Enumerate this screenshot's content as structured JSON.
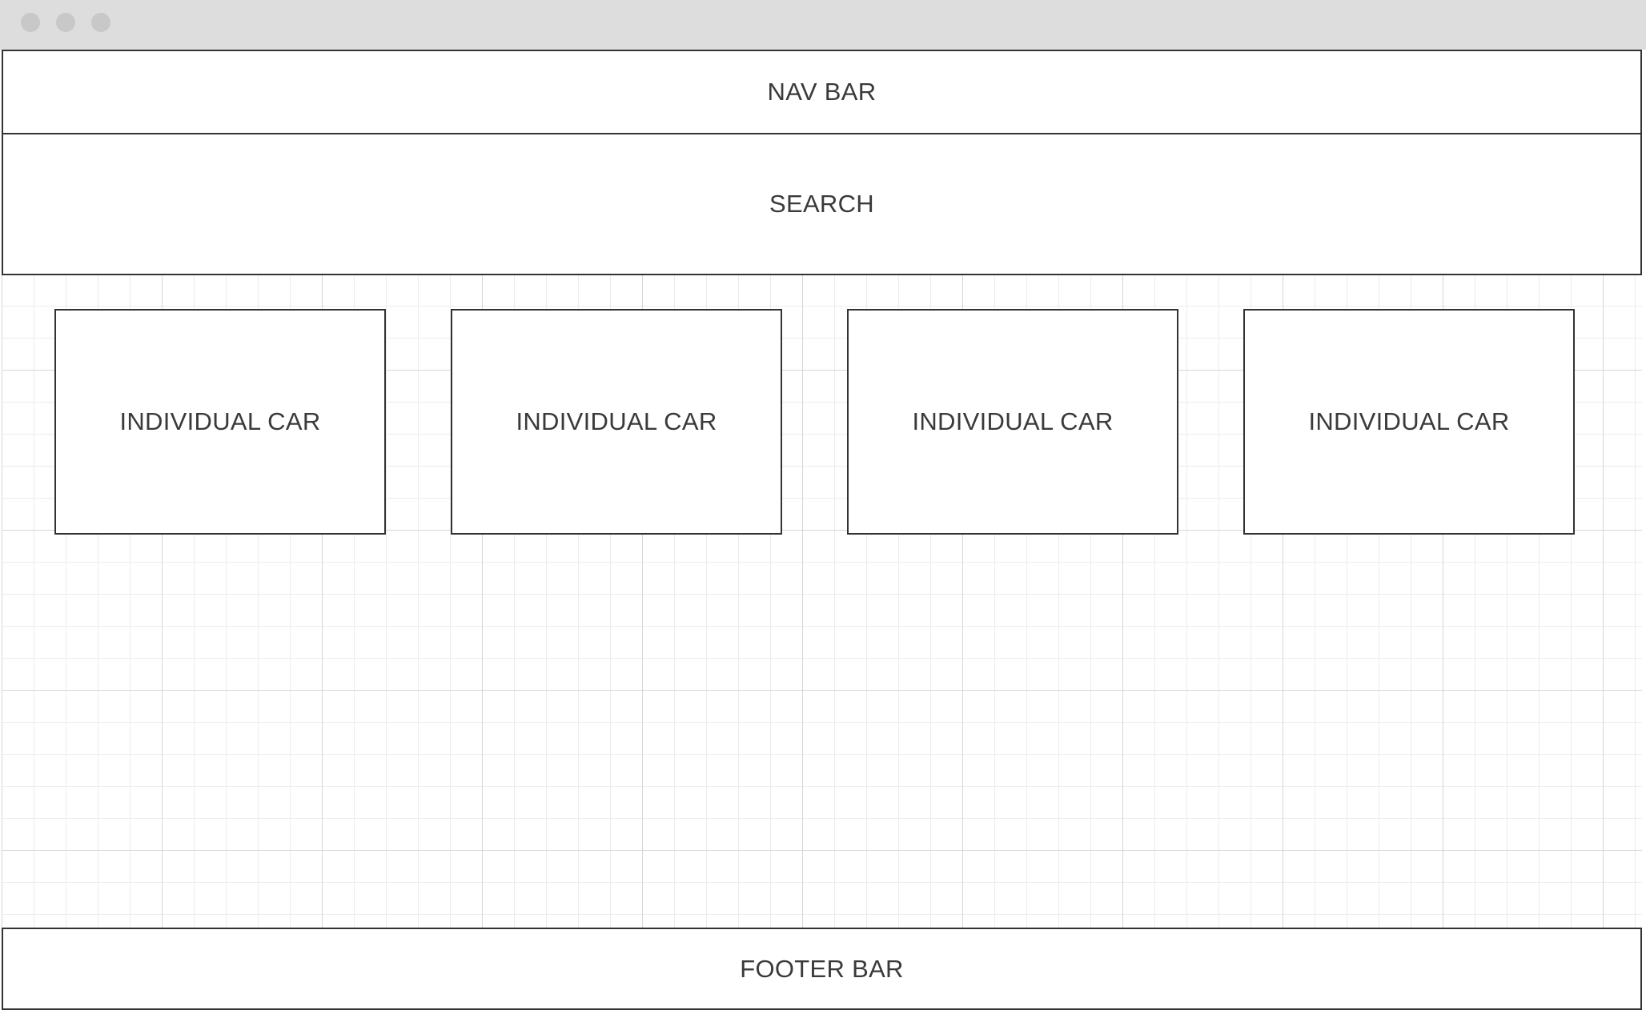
{
  "nav": {
    "label": "NAV BAR"
  },
  "search": {
    "label": "SEARCH"
  },
  "cars": [
    {
      "label": "INDIVIDUAL CAR"
    },
    {
      "label": "INDIVIDUAL CAR"
    },
    {
      "label": "INDIVIDUAL CAR"
    },
    {
      "label": "INDIVIDUAL CAR"
    }
  ],
  "footer": {
    "label": "FOOTER BAR"
  },
  "colors": {
    "titlebar": "#dddddd",
    "window_dot": "#c8c8c8",
    "border": "#333333",
    "text": "#3a3a3a",
    "grid_major": "#d6d6d6",
    "grid_minor": "#ececec"
  },
  "icons": [
    "window-close-dot-icon",
    "window-minimize-dot-icon",
    "window-maximize-dot-icon"
  ]
}
